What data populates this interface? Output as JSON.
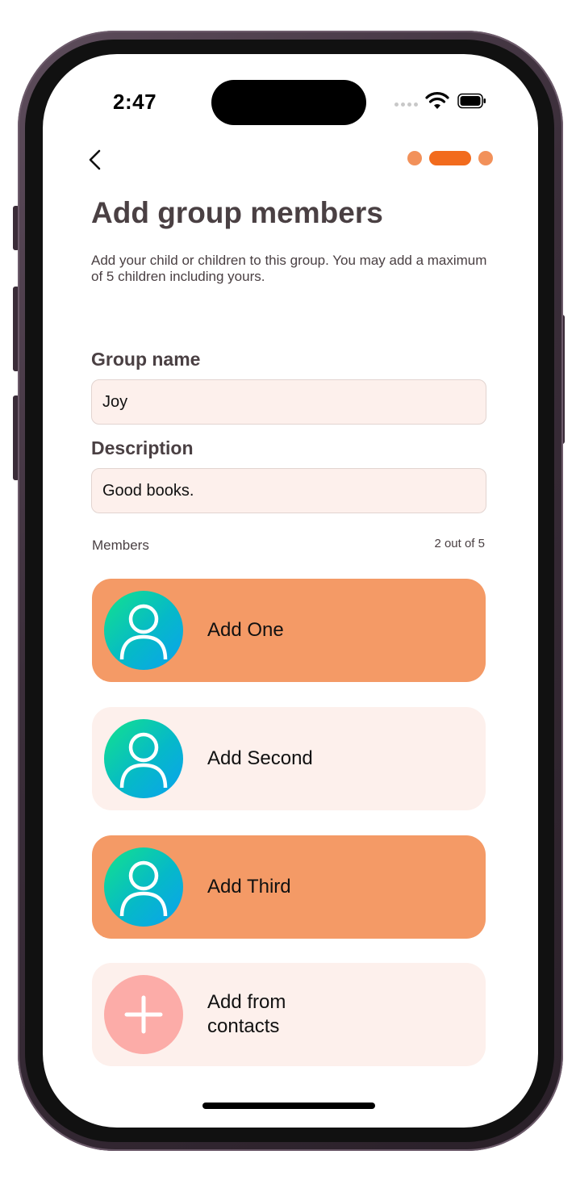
{
  "status_bar": {
    "time": "2:47"
  },
  "nav": {
    "back_icon": "chevron-left-icon",
    "steps": {
      "total": 3,
      "current": 2
    }
  },
  "page": {
    "title": "Add group members",
    "subtitle": "Add your child or children to this group. You may add a maximum of 5 children including yours."
  },
  "form": {
    "group_name_label": "Group name",
    "group_name_value": "Joy",
    "description_label": "Description",
    "description_value": "Good books."
  },
  "members": {
    "label": "Members",
    "count_text": "2 out of 5",
    "items": [
      {
        "label": "Add One",
        "icon": "user-icon",
        "style": "orange"
      },
      {
        "label": "Add Second",
        "icon": "user-icon",
        "style": "light"
      },
      {
        "label": "Add Third",
        "icon": "user-icon",
        "style": "orange"
      },
      {
        "label": "Add from contacts",
        "icon": "plus-icon",
        "style": "light"
      }
    ]
  },
  "colors": {
    "accent": "#f26b1d",
    "card_orange": "#f49a66",
    "card_light": "#fdf0ec",
    "field_bg": "#fdf0ec",
    "text_dark": "#4a4043"
  }
}
